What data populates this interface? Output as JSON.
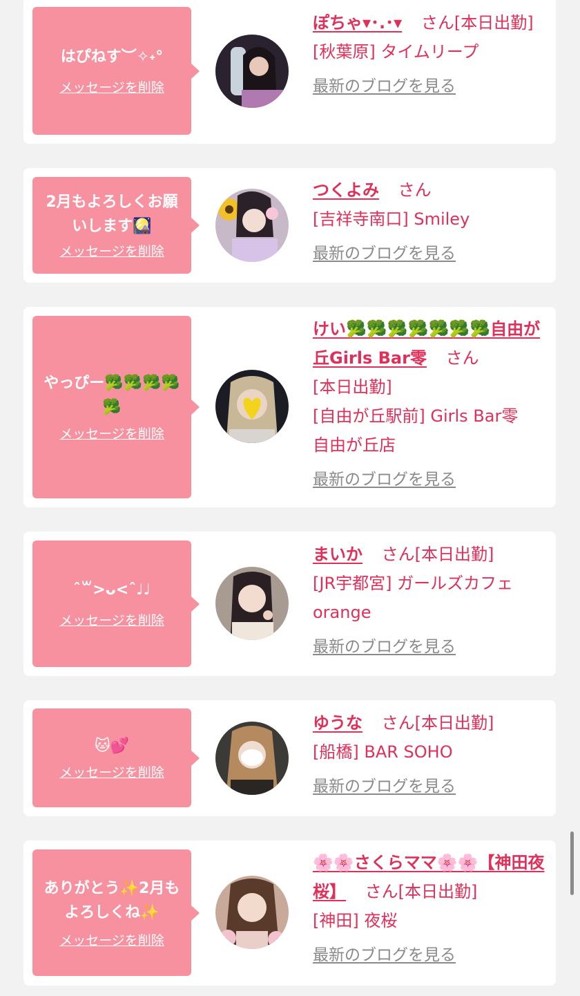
{
  "delete_label": "メッセージを削除",
  "blog_label": "最新のブログを見る",
  "san_label": "さん",
  "colors": {
    "bubble": "#f8919f",
    "accent": "#e0305a",
    "muted": "#8a8a8a",
    "background": "#f2f2f2"
  },
  "cards": [
    {
      "message": "はぴねす︶✧˖°",
      "name": "ぽちゃ▾･.･▾",
      "status": "[本日出勤]",
      "shop": "[秋葉原] タイムリープ"
    },
    {
      "message": "2月もよろしくお願いします🎑",
      "name": "つくよみ",
      "status": "",
      "shop": "[吉祥寺南口] Smiley"
    },
    {
      "message": "やっぴー🥦🥦🥦🥦🥦",
      "name": "けい🥦🥦🥦🥦🥦🥦🥦自由が丘Girls Bar零",
      "status": "[本日出勤]",
      "shop": "[自由が丘駅前] Girls Bar零　自由が丘店"
    },
    {
      "message": "ˆ꒳>ᴗ<ˆ♩♩",
      "name": "まいか",
      "status": "[本日出勤]",
      "shop": "[JR宇都宮] ガールズカフェorange"
    },
    {
      "message": "🐱💕",
      "name": "ゆうな",
      "status": "[本日出勤]",
      "shop": "[船橋] BAR SOHO"
    },
    {
      "message": "ありがとう✨2月もよろしくね✨",
      "name": "🌸🌸さくらママ🌸🌸【神田夜桜】",
      "status": "[本日出勤]",
      "shop": "[神田] 夜桜"
    }
  ]
}
